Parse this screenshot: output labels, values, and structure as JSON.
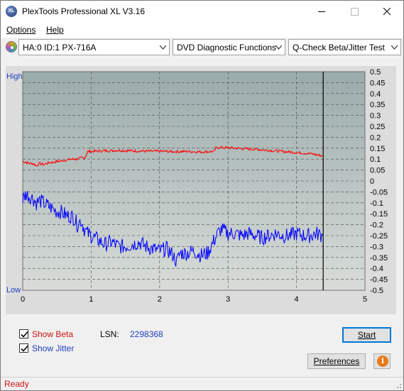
{
  "window": {
    "title": "PlexTools Professional XL V3.16",
    "icon_text": "XL"
  },
  "menu": {
    "items": [
      "Options",
      "Help"
    ]
  },
  "toolbar": {
    "drive": "HA:0 ID:1  PX-716A",
    "function": "DVD Diagnostic Functions",
    "test": "Q-Check Beta/Jitter Test"
  },
  "chart_data": {
    "type": "line",
    "x_ticks": [
      "0",
      "1",
      "2",
      "3",
      "4",
      "5"
    ],
    "xlim": [
      0,
      5
    ],
    "left_labels": {
      "high": "High",
      "low": "Low"
    },
    "right_ticks": [
      "0.5",
      "0.45",
      "0.4",
      "0.35",
      "0.3",
      "0.25",
      "0.2",
      "0.15",
      "0.1",
      "0.05",
      "0",
      "-0.05",
      "-0.1",
      "-0.15",
      "-0.2",
      "-0.25",
      "-0.3",
      "-0.35",
      "-0.4",
      "-0.45",
      "-0.5"
    ],
    "ylim": [
      -0.5,
      0.5
    ],
    "end_marker_x": 4.39,
    "grid": true,
    "colors": {
      "beta": "#ff0000",
      "jitter": "#0000ff",
      "plot_top": "#9aabab",
      "plot_bottom": "#d8dcd8"
    },
    "series": [
      {
        "key": "beta",
        "x": [
          0.0,
          0.05,
          0.1,
          0.15,
          0.2,
          0.25,
          0.3,
          0.35,
          0.4,
          0.45,
          0.5,
          0.55,
          0.6,
          0.65,
          0.7,
          0.75,
          0.8,
          0.85,
          0.9,
          0.93,
          0.95,
          1.0,
          1.2,
          1.4,
          1.6,
          1.8,
          2.0,
          2.2,
          2.4,
          2.6,
          2.8,
          2.82,
          2.84,
          3.0,
          3.2,
          3.4,
          3.6,
          3.8,
          4.0,
          4.2,
          4.38
        ],
        "values": [
          0.09,
          0.085,
          0.08,
          0.08,
          0.07,
          0.08,
          0.075,
          0.08,
          0.085,
          0.085,
          0.09,
          0.09,
          0.095,
          0.095,
          0.1,
          0.1,
          0.1,
          0.105,
          0.105,
          0.12,
          0.135,
          0.135,
          0.138,
          0.14,
          0.138,
          0.136,
          0.136,
          0.134,
          0.135,
          0.133,
          0.135,
          0.15,
          0.153,
          0.152,
          0.148,
          0.145,
          0.14,
          0.135,
          0.13,
          0.125,
          0.115
        ]
      },
      {
        "key": "jitter",
        "x": [
          0.0,
          0.05,
          0.1,
          0.15,
          0.2,
          0.25,
          0.3,
          0.35,
          0.4,
          0.45,
          0.5,
          0.55,
          0.6,
          0.65,
          0.7,
          0.75,
          0.8,
          0.85,
          0.9,
          0.95,
          1.0,
          1.1,
          1.2,
          1.3,
          1.4,
          1.5,
          1.6,
          1.7,
          1.8,
          1.9,
          2.0,
          2.1,
          2.2,
          2.25,
          2.3,
          2.4,
          2.5,
          2.6,
          2.7,
          2.8,
          2.85,
          2.9,
          3.0,
          3.1,
          3.2,
          3.3,
          3.4,
          3.5,
          3.6,
          3.7,
          3.8,
          3.9,
          4.0,
          4.1,
          4.2,
          4.3,
          4.38
        ],
        "values": [
          -0.08,
          -0.06,
          -0.07,
          -0.08,
          -0.1,
          -0.09,
          -0.1,
          -0.11,
          -0.12,
          -0.13,
          -0.14,
          -0.14,
          -0.15,
          -0.16,
          -0.16,
          -0.17,
          -0.2,
          -0.18,
          -0.22,
          -0.24,
          -0.25,
          -0.27,
          -0.29,
          -0.28,
          -0.3,
          -0.3,
          -0.29,
          -0.28,
          -0.3,
          -0.31,
          -0.32,
          -0.31,
          -0.34,
          -0.37,
          -0.33,
          -0.33,
          -0.32,
          -0.34,
          -0.33,
          -0.27,
          -0.24,
          -0.22,
          -0.24,
          -0.24,
          -0.25,
          -0.24,
          -0.25,
          -0.26,
          -0.25,
          -0.24,
          -0.25,
          -0.25,
          -0.24,
          -0.25,
          -0.25,
          -0.24,
          -0.25
        ]
      }
    ]
  },
  "options": {
    "show_beta": {
      "checked": true,
      "label": "Show Beta"
    },
    "show_jitter": {
      "checked": true,
      "label": "Show Jitter"
    }
  },
  "lsn": {
    "label": "LSN:",
    "value": "2298368"
  },
  "buttons": {
    "start": "Start",
    "preferences": "Preferences",
    "info_icon": "info-icon"
  },
  "status": {
    "text": "Ready"
  }
}
